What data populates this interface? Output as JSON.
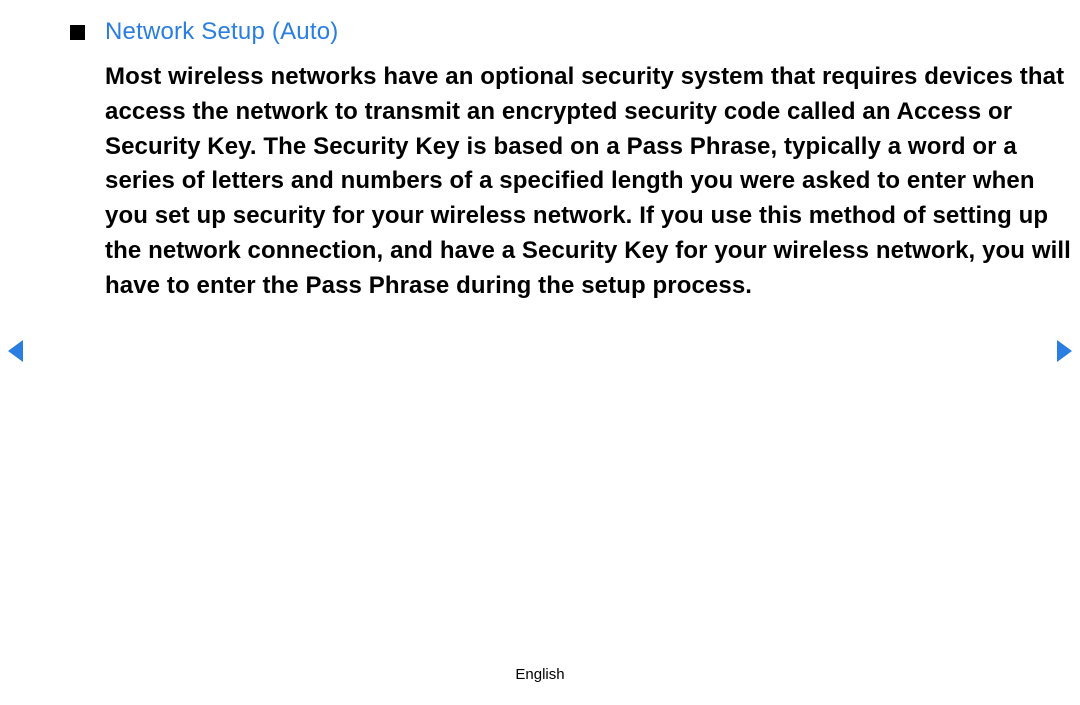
{
  "heading": "Network Setup (Auto)",
  "body": "Most wireless networks have an optional security system that requires devices that access the network to transmit an encrypted security code called an Access or Security Key. The Security Key is based on a Pass Phrase, typically a word or a series of letters and numbers of a specified length you were asked to enter when you set up security for your wireless network. If you use this method of setting up the network connection, and have a Security Key for your wireless network, you will have to enter the Pass Phrase during the setup process.",
  "footer_language": "English"
}
